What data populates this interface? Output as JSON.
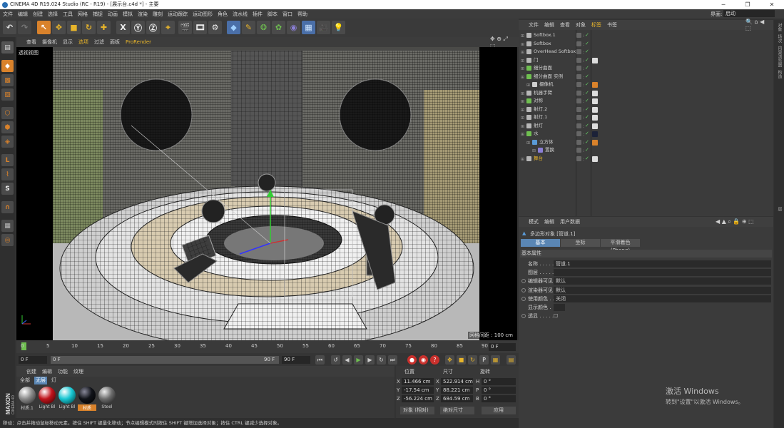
{
  "window": {
    "title": "CINEMA 4D R19.024 Studio (RC - R19) - [展示台.c4d *] - 主要"
  },
  "menubar": {
    "items": [
      "文件",
      "编辑",
      "创建",
      "选择",
      "工具",
      "网格",
      "捕捉",
      "动画",
      "模拟",
      "渲染",
      "雕刻",
      "运动跟踪",
      "运动图形",
      "角色",
      "流水线",
      "插件",
      "脚本",
      "窗口",
      "帮助"
    ],
    "layout_label": "界面:",
    "layout_value": "启动"
  },
  "viewport": {
    "menu": [
      "查看",
      "摄像机",
      "显示",
      "选项",
      "过滤",
      "面板",
      "ProRender"
    ],
    "label": "透视视图",
    "grid_spacing": "网格间距 : 100 cm"
  },
  "timeline": {
    "ticks": [
      "0",
      "5",
      "10",
      "15",
      "20",
      "25",
      "30",
      "35",
      "40",
      "45",
      "50",
      "55",
      "60",
      "65",
      "70",
      "75",
      "80",
      "85",
      "90"
    ],
    "frame_end_field": "0 F"
  },
  "timectrl": {
    "start": "0 F",
    "range_start": "0 F",
    "range_end": "90 F",
    "end": "90 F"
  },
  "materials": {
    "tabs": [
      "创建",
      "编辑",
      "功能",
      "纹理"
    ],
    "filters": [
      "全部",
      "无层",
      "灯"
    ],
    "items": [
      {
        "name": "材质.1",
        "color": "#8a8a8a"
      },
      {
        "name": "Light Bl",
        "color": "#c0141c"
      },
      {
        "name": "Light Bl",
        "color": "#18c6d2"
      },
      {
        "name": "材质",
        "color": "#111319"
      },
      {
        "name": "Steel",
        "color": "#6c6c6c"
      }
    ]
  },
  "coords": {
    "headers": [
      "位置",
      "尺寸",
      "旋转"
    ],
    "rows": [
      {
        "axis": "X",
        "pos": "11.466 cm",
        "size": "522.914 cm",
        "rot_axis": "H",
        "rot": "0 °"
      },
      {
        "axis": "Y",
        "pos": "-17.54 cm",
        "size": "88.221 cm",
        "rot_axis": "P",
        "rot": "0 °"
      },
      {
        "axis": "Z",
        "pos": "-56.224 cm",
        "size": "684.59 cm",
        "rot_axis": "B",
        "rot": "0 °"
      }
    ],
    "mode": "对象 (相对)",
    "size_mode": "绝对尺寸",
    "apply": "应用"
  },
  "status": {
    "text": "移动：点击并拖动鼠标移动元素。按住 SHIFT 键量化移动；节点编辑模式时按住 SHIFT 键增加选择对象；按住 CTRL 键减少选择对象。"
  },
  "objects": {
    "menu": [
      "文件",
      "编辑",
      "查看",
      "对象",
      "标签",
      "书签"
    ],
    "items": [
      {
        "name": "Softbox.1",
        "indent": 0,
        "icon": "#b7b7b7",
        "tag": ""
      },
      {
        "name": "Softbox",
        "indent": 0,
        "icon": "#b7b7b7",
        "tag": ""
      },
      {
        "name": "OverHead Softbox",
        "indent": 0,
        "icon": "#b7b7b7",
        "tag": ""
      },
      {
        "name": "门",
        "indent": 0,
        "icon": "#b7b7b7",
        "tag": "#ddd"
      },
      {
        "name": "细分曲面",
        "indent": 0,
        "icon": "#6fbf50",
        "tag": ""
      },
      {
        "name": "细分曲面 实例",
        "indent": 0,
        "icon": "#6fbf50",
        "tag": ""
      },
      {
        "name": "摄像机",
        "indent": 1,
        "icon": "#cfcfcf",
        "tag": "#d9822b"
      },
      {
        "name": "机器手臂",
        "indent": 0,
        "icon": "#b7b7b7",
        "tag": "#ddd"
      },
      {
        "name": "对称",
        "indent": 0,
        "icon": "#6fbf50",
        "tag": "#ddd"
      },
      {
        "name": "射灯.2",
        "indent": 0,
        "icon": "#b7b7b7",
        "tag": "#ddd"
      },
      {
        "name": "射灯.1",
        "indent": 0,
        "icon": "#b7b7b7",
        "tag": "#ddd"
      },
      {
        "name": "射灯",
        "indent": 0,
        "icon": "#b7b7b7",
        "tag": "#ddd"
      },
      {
        "name": "水",
        "indent": 0,
        "icon": "#6fbf50",
        "tag": "#1c2238"
      },
      {
        "name": "立方体",
        "indent": 1,
        "icon": "#5a9ad6",
        "tag": "#d9822b"
      },
      {
        "name": "置换",
        "indent": 2,
        "icon": "#8b7fd6",
        "tag": ""
      },
      {
        "name": "舞台",
        "indent": 0,
        "icon": "#b7b7b7",
        "tag": "#ddd",
        "highlight": true
      }
    ]
  },
  "attributes": {
    "menu": [
      "模式",
      "编辑",
      "用户数据"
    ],
    "title": "多边形对象 [管道.1]",
    "tabs": [
      "基本",
      "坐标",
      "平滑着色(Phong)"
    ],
    "section": "基本属性",
    "rows": [
      {
        "label": "名称 . . . . . .",
        "value": "管道.1",
        "radio": false
      },
      {
        "label": "图层 . . . . . .",
        "value": "",
        "radio": false
      },
      {
        "label": "编辑器可见",
        "value": "默认",
        "radio": true
      },
      {
        "label": "渲染器可见",
        "value": "默认",
        "radio": true
      },
      {
        "label": "使用颜色 . . .",
        "value": "关闭",
        "radio": true
      },
      {
        "label": "显示颜色 .",
        "value": "",
        "radio": false
      },
      {
        "label": "透显 . . . . . .",
        "value": "",
        "radio": true
      }
    ]
  },
  "right_strip": [
    "对象",
    "场次",
    "内容浏览器",
    "构造",
    "层"
  ],
  "watermark": {
    "line1": "激活 Windows",
    "line2": "转到\"设置\"以激活 Windows。"
  }
}
